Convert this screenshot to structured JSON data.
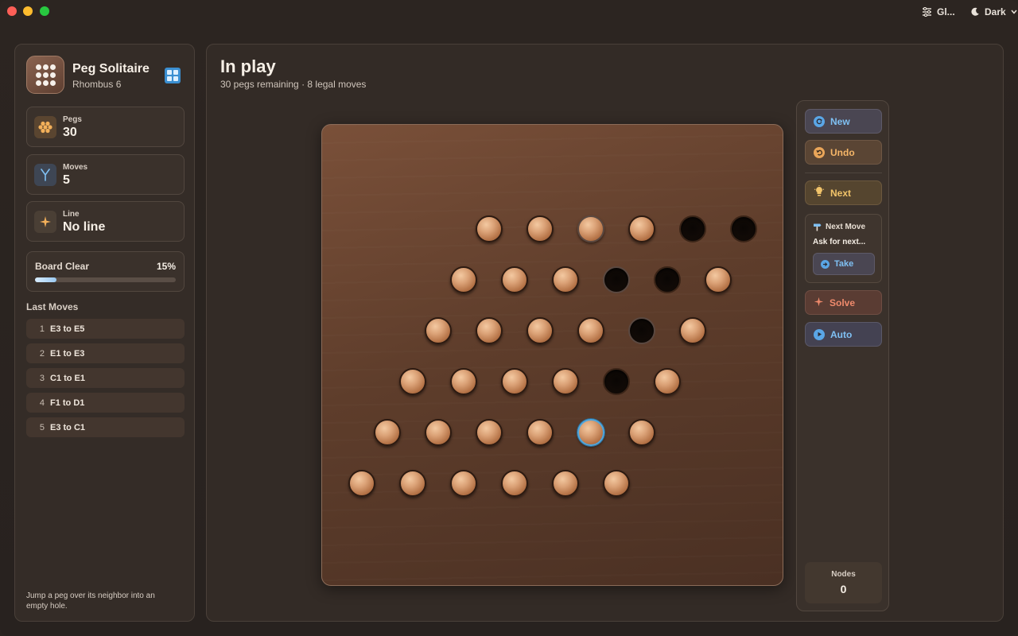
{
  "titlebar": {
    "filter_label": "Gl...",
    "theme_label": "Dark"
  },
  "sidebar": {
    "app_title": "Peg Solitaire",
    "app_subtitle": "Rhombus 6",
    "stats": {
      "pegs": {
        "label": "Pegs",
        "value": "30"
      },
      "moves": {
        "label": "Moves",
        "value": "5"
      },
      "line": {
        "label": "Line",
        "value": "No line"
      }
    },
    "progress": {
      "label": "Board Clear",
      "percent_text": "15%",
      "fraction": 0.15
    },
    "moves_heading": "Last Moves",
    "move_list": [
      {
        "num": "1",
        "text": "E3 to E5"
      },
      {
        "num": "2",
        "text": "E1 to E3"
      },
      {
        "num": "3",
        "text": "C1 to E1"
      },
      {
        "num": "4",
        "text": "F1 to D1"
      },
      {
        "num": "5",
        "text": "E3 to C1"
      }
    ],
    "hint": "Jump a peg over its neighbor into an empty hole."
  },
  "main": {
    "title": "In play",
    "subtitle": "30 pegs remaining · 8 legal moves"
  },
  "board": {
    "rows": [
      [
        "peg",
        "peg",
        "peg-highlighted",
        "peg",
        "hole",
        "hole"
      ],
      [
        "peg",
        "peg",
        "peg",
        "hole-highlighted",
        "hole",
        "peg"
      ],
      [
        "peg",
        "peg",
        "peg",
        "peg",
        "hole-highlighted",
        "peg"
      ],
      [
        "peg",
        "peg",
        "peg",
        "peg",
        "hole",
        "peg"
      ],
      [
        "peg",
        "peg",
        "peg",
        "peg",
        "peg-selected",
        "peg"
      ],
      [
        "peg",
        "peg",
        "peg",
        "peg",
        "peg",
        "peg"
      ]
    ]
  },
  "controls": {
    "new_label": "New",
    "undo_label": "Undo",
    "next_label": "Next",
    "next_move_title": "Next Move",
    "next_move_text": "Ask for next...",
    "take_label": "Take",
    "solve_label": "Solve",
    "auto_label": "Auto",
    "nodes_label": "Nodes",
    "nodes_value": "0"
  },
  "colors": {
    "accent_blue": "#7fc0f3",
    "accent_orange": "#f6b668",
    "accent_red": "#f08a6c",
    "peg": "#dba277",
    "hole": "#0a0604"
  }
}
